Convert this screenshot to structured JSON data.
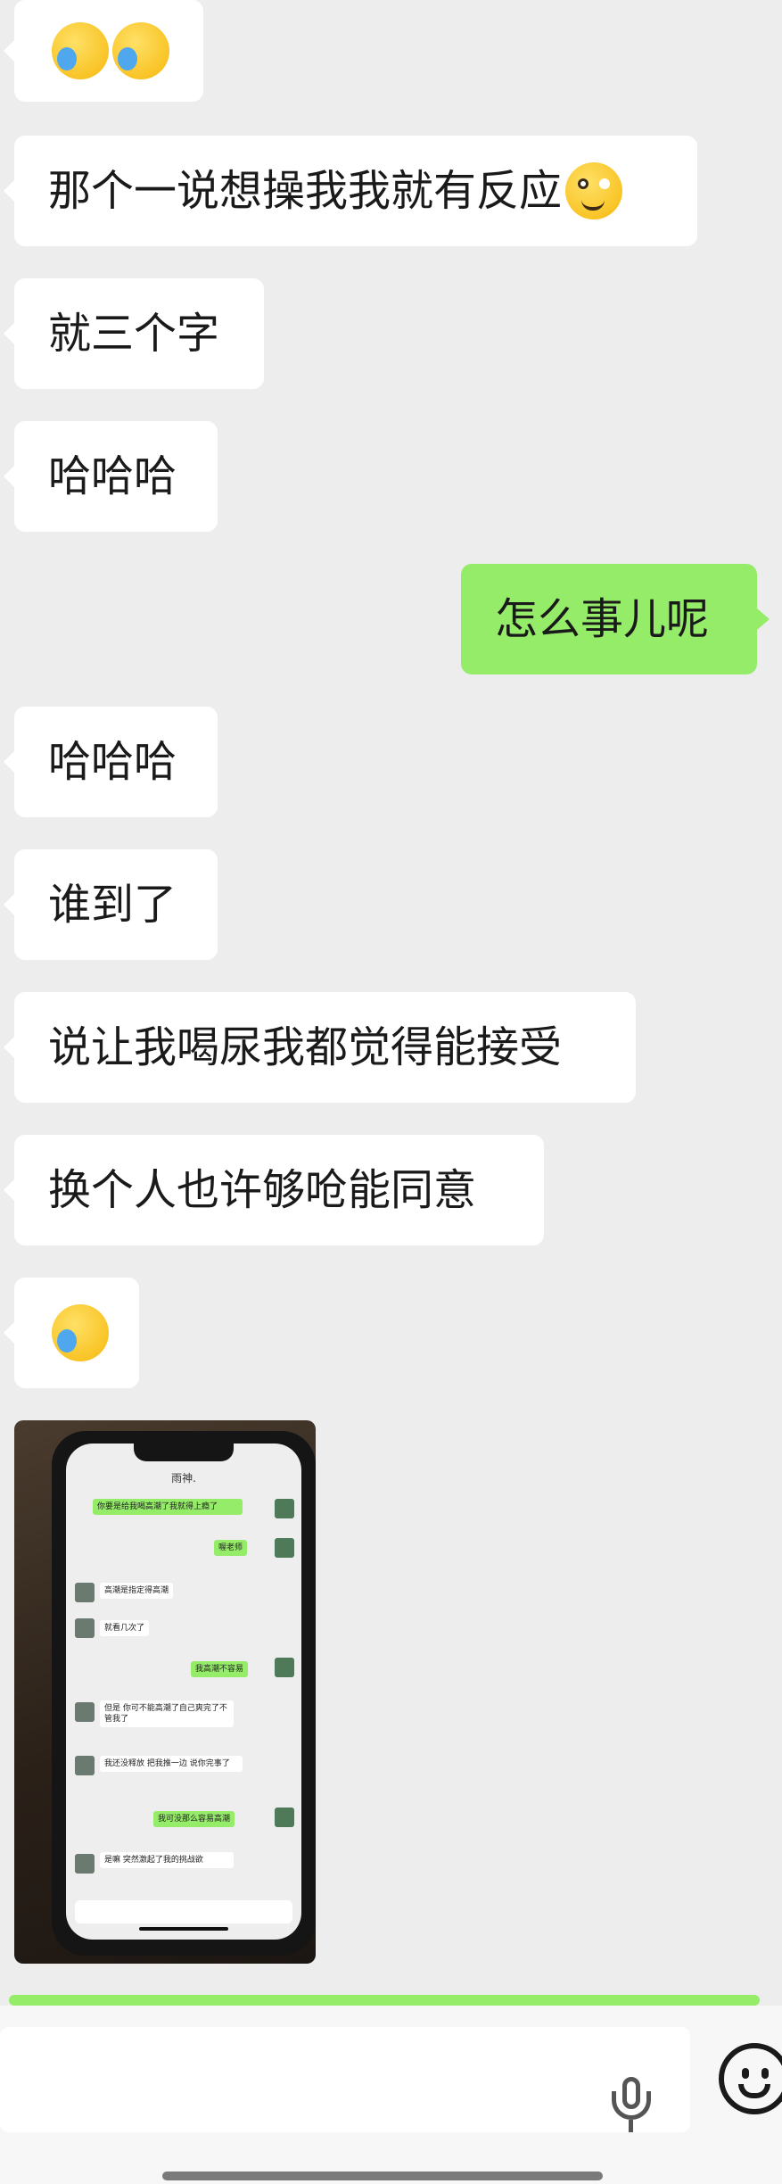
{
  "messages": [
    {
      "text": "",
      "emojis": [
        "cry-laugh-emoji",
        "cry-laugh-emoji"
      ]
    },
    {
      "text": "那个一说想操我我就有反应",
      "emojis": [
        "smirk-emoji"
      ]
    },
    {
      "text": "就三个字"
    },
    {
      "text": "哈哈哈"
    },
    {
      "text": "怎么事儿呢"
    },
    {
      "text": "哈哈哈"
    },
    {
      "text": "谁到了"
    },
    {
      "text": "说让我喝尿我都觉得能接受"
    },
    {
      "text": "换个人也许够呛能同意"
    },
    {
      "text": "",
      "emojis": [
        "cry-laugh-emoji"
      ]
    }
  ],
  "photo": {
    "title": "雨神.",
    "lines": [
      "你要是给我喝高潮了我就得上瘾了",
      "喔老师",
      "高潮是指定得高潮",
      "就看几次了",
      "我高潮不容易",
      "但是 你可不能高潮了自己爽完了不管我了",
      "我还没释放 把我推一边 说你完事了",
      "我可没那么容易高潮",
      "是嘛 突然激起了我的挑战欲"
    ]
  },
  "colors": {
    "sent": "#95ec69",
    "received": "#ffffff",
    "background": "#ededed"
  },
  "icons": {
    "voice": "microphone-icon",
    "emoji": "smiley-face-icon"
  }
}
